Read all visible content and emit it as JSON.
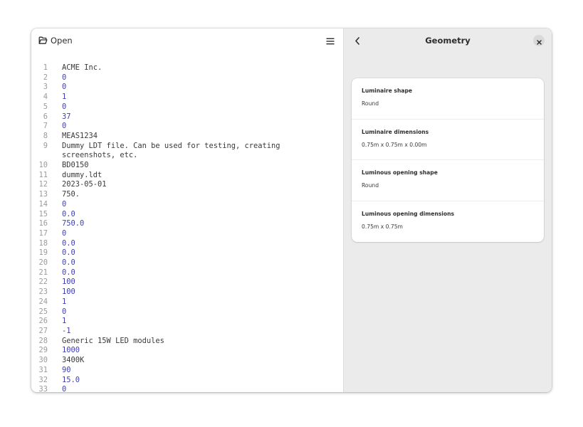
{
  "header": {
    "open_label": "Open"
  },
  "editor": {
    "lines": [
      {
        "n": "1",
        "text": "ACME Inc.",
        "kind": "text"
      },
      {
        "n": "2",
        "text": "0",
        "kind": "num"
      },
      {
        "n": "3",
        "text": "0",
        "kind": "num"
      },
      {
        "n": "4",
        "text": "1",
        "kind": "num"
      },
      {
        "n": "5",
        "text": "0",
        "kind": "num"
      },
      {
        "n": "6",
        "text": "37",
        "kind": "num"
      },
      {
        "n": "7",
        "text": "0",
        "kind": "num"
      },
      {
        "n": "8",
        "text": "MEAS1234",
        "kind": "text"
      },
      {
        "n": "9",
        "text": "Dummy LDT file. Can be used for testing, creating\nscreenshots, etc.",
        "kind": "text"
      },
      {
        "n": "10",
        "text": "BD0150",
        "kind": "text"
      },
      {
        "n": "11",
        "text": "dummy.ldt",
        "kind": "text"
      },
      {
        "n": "12",
        "text": "2023-05-01",
        "kind": "text"
      },
      {
        "n": "13",
        "text": "750.",
        "kind": "text"
      },
      {
        "n": "14",
        "text": "0",
        "kind": "num"
      },
      {
        "n": "15",
        "text": "0.0",
        "kind": "num"
      },
      {
        "n": "16",
        "text": "750.0",
        "kind": "num"
      },
      {
        "n": "17",
        "text": "0",
        "kind": "num"
      },
      {
        "n": "18",
        "text": "0.0",
        "kind": "num"
      },
      {
        "n": "19",
        "text": "0.0",
        "kind": "num"
      },
      {
        "n": "20",
        "text": "0.0",
        "kind": "num"
      },
      {
        "n": "21",
        "text": "0.0",
        "kind": "num"
      },
      {
        "n": "22",
        "text": "100",
        "kind": "num"
      },
      {
        "n": "23",
        "text": "100",
        "kind": "num"
      },
      {
        "n": "24",
        "text": "1",
        "kind": "num"
      },
      {
        "n": "25",
        "text": "0",
        "kind": "num"
      },
      {
        "n": "26",
        "text": "1",
        "kind": "num"
      },
      {
        "n": "27",
        "text": "-1",
        "kind": "num"
      },
      {
        "n": "28",
        "text": "Generic 15W LED modules",
        "kind": "text"
      },
      {
        "n": "29",
        "text": "1000",
        "kind": "num"
      },
      {
        "n": "30",
        "text": "3400K",
        "kind": "text"
      },
      {
        "n": "31",
        "text": "90",
        "kind": "num"
      },
      {
        "n": "32",
        "text": "15.0",
        "kind": "num"
      },
      {
        "n": "33",
        "text": "0",
        "kind": "num"
      }
    ]
  },
  "panel": {
    "title": "Geometry",
    "rows": [
      {
        "label": "Luminaire shape",
        "value": "Round"
      },
      {
        "label": "Luminaire dimensions",
        "value": "0.75m x 0.75m x 0.00m"
      },
      {
        "label": "Luminous opening shape",
        "value": "Round"
      },
      {
        "label": "Luminous opening dimensions",
        "value": "0.75m x 0.75m"
      }
    ]
  },
  "colors": {
    "number_text": "#3f3fae",
    "plain_text": "#3a3a3a",
    "line_number": "#9a9a9a",
    "sidebar_bg": "#ebebeb"
  },
  "icons": {
    "open": "folder-open-icon",
    "menu": "hamburger-menu-icon",
    "back": "chevron-left-icon",
    "close": "close-icon"
  }
}
